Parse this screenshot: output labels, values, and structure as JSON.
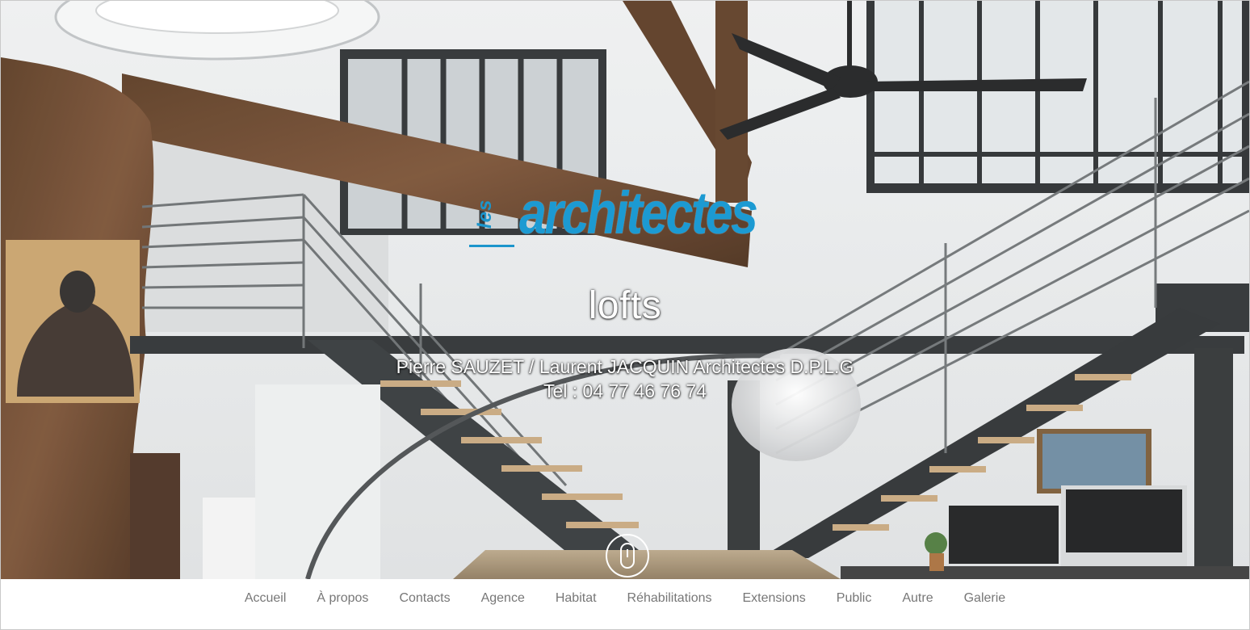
{
  "logo": {
    "prefix": "les",
    "word": "architectes"
  },
  "hero": {
    "title": "lofts",
    "names": "Pierre SAUZET / Laurent JACQUIN Architectes D.P.L.G",
    "phone": "Tel : 04 77 46 76 74"
  },
  "nav": {
    "items": [
      {
        "label": "Accueil"
      },
      {
        "label": "À propos"
      },
      {
        "label": "Contacts"
      },
      {
        "label": "Agence"
      },
      {
        "label": "Habitat"
      },
      {
        "label": "Réhabilitations"
      },
      {
        "label": "Extensions"
      },
      {
        "label": "Public"
      },
      {
        "label": "Autre"
      },
      {
        "label": "Galerie"
      }
    ]
  },
  "colors": {
    "brand": "#1c9ad2",
    "nav_text": "#777777"
  },
  "icons": {
    "scroll": "mouse-scroll-icon"
  }
}
